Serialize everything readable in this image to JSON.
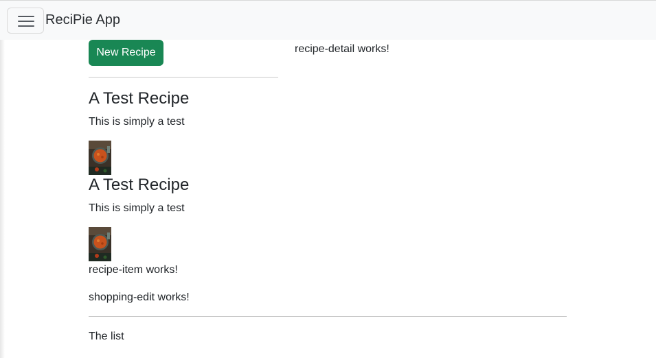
{
  "navbar": {
    "brand": "ReciPie App",
    "toggler_icon": "hamburger-menu-icon"
  },
  "recipe_list": {
    "new_recipe_label": "New Recipe",
    "items": [
      {
        "name": "A Test Recipe",
        "description": "This is simply a test",
        "image": "recipe-photo"
      },
      {
        "name": "A Test Recipe",
        "description": "This is simply a test",
        "image": "recipe-photo"
      }
    ],
    "item_component_text": "recipe-item works!"
  },
  "recipe_detail": {
    "text": "recipe-detail works!"
  },
  "shopping_edit": {
    "text": "shopping-edit works!"
  },
  "shopping_list": {
    "text": "The list"
  },
  "colors": {
    "navbar_bg": "#f8f9fa",
    "success": "#198754",
    "text": "#212529"
  }
}
